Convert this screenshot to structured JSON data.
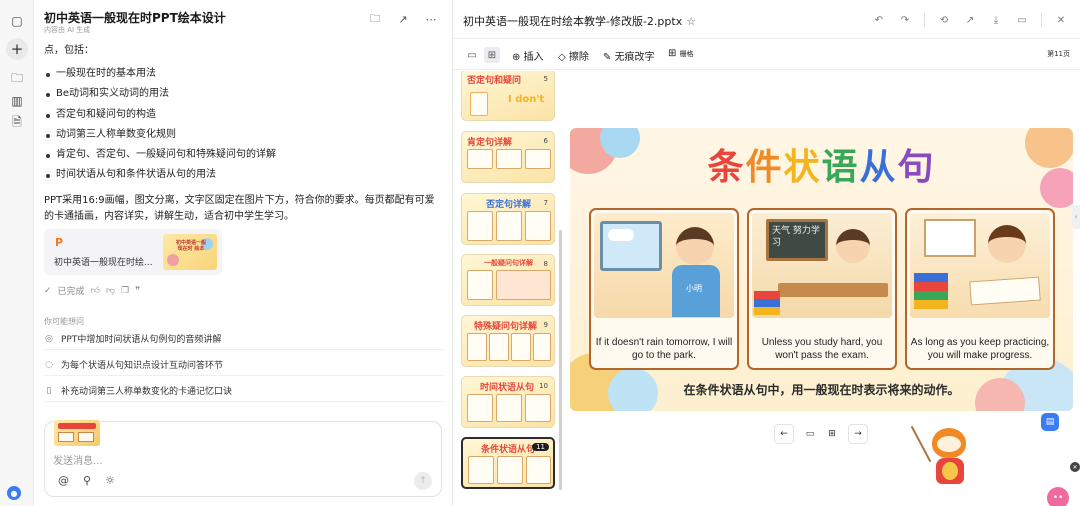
{
  "chat": {
    "title": "初中英语一般现在时PPT绘本设计",
    "subtitle": "内容由 AI 生成",
    "intro": "点，包括：",
    "bullets": [
      "一般现在时的基本用法",
      "Be动词和实义动词的用法",
      "否定句和疑问句的构造",
      "动词第三人称单数变化规则",
      "肯定句、否定句、一般疑问句和特殊疑问句的详解",
      "时间状语从句和条件状语从句的用法"
    ],
    "paragraph": "PPT采用16:9画幅，图文分离，文字区固定在图片下方，符合你的要求。每页都配有可爱的卡通插画，内容详实，讲解生动，适合初中学生学习。",
    "file_card": {
      "badge": "P",
      "name": "初中英语一般现在时绘...",
      "thumb_text": "初中英语一般现在时 绘本"
    },
    "status": "已完成",
    "suggest_title": "你可能想问",
    "suggestions": [
      "PPT中增加时间状语从句例句的音频讲解",
      "为每个状语从句知识点设计互动问答环节",
      "补充动词第三人称单数变化的卡通记忆口诀"
    ],
    "input_placeholder": "发送消息..."
  },
  "editor": {
    "title": "初中英语一般现在时绘本教学-修改版-2.pptx",
    "toolbar": {
      "insert": "插入",
      "erase": "擦除",
      "no_trace": "无痕改字",
      "grid": "栅格",
      "page": "第11页"
    },
    "thumbnails": [
      {
        "title": "否定句和疑问",
        "num": "5",
        "color": "#e8463c"
      },
      {
        "title": "肯定句详解",
        "num": "6",
        "color": "#e8463c"
      },
      {
        "title": "否定句详解",
        "num": "7",
        "color": "#3a6fd8"
      },
      {
        "title": "一般疑问句详解",
        "num": "8",
        "color": "#e8463c"
      },
      {
        "title": "特殊疑问句详解",
        "num": "9",
        "color": "#e8463c"
      },
      {
        "title": "时间状语从句",
        "num": "10",
        "color": "#e8463c"
      },
      {
        "title": "条件状语从句",
        "num": "11",
        "color": "#e8463c"
      }
    ],
    "slide": {
      "title_chars": [
        {
          "ch": "条",
          "color": "#e8463c"
        },
        {
          "ch": "件",
          "color": "#f08a24"
        },
        {
          "ch": "状",
          "color": "#f2b51d"
        },
        {
          "ch": "语",
          "color": "#3aa657"
        },
        {
          "ch": "从",
          "color": "#3a6fd8"
        },
        {
          "ch": "句",
          "color": "#8a4bc2"
        }
      ],
      "panels": [
        {
          "caption": "If it doesn't rain tomorrow, I will go to the park.",
          "scene_text": "小明"
        },
        {
          "caption": "Unless you study hard, you won't pass the exam.",
          "scene_text": "天气 努力学习"
        },
        {
          "caption": "As long as you keep practicing, you will make progress.",
          "scene_text": ""
        }
      ],
      "footer": "在条件状语从句中，用一般现在时表示将来的动作。"
    }
  },
  "colors": {
    "accent": "#3b7cf5",
    "slide_border": "#b4652c",
    "ppt_badge": "#f07a22"
  }
}
